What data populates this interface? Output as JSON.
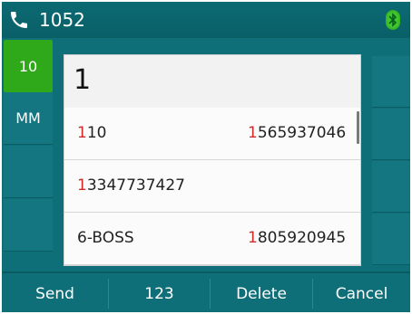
{
  "status": {
    "line_number": "1052"
  },
  "left_buttons": [
    {
      "label": "10"
    },
    {
      "label": "MM"
    }
  ],
  "search": {
    "input_value": "1"
  },
  "results": [
    {
      "name_prefix": "1",
      "name_rest": "10",
      "number_prefix": "1",
      "number_rest": "565937046"
    },
    {
      "name_prefix": "1",
      "name_rest": "3347737427",
      "number_prefix": "",
      "number_rest": ""
    },
    {
      "name_prefix": "",
      "name_rest": "6-BOSS",
      "number_prefix": "1",
      "number_rest": "805920945"
    }
  ],
  "softkeys": [
    "Send",
    "123",
    "Delete",
    "Cancel"
  ],
  "colors": {
    "background": "#0f6f78",
    "active_button": "#2fa81a",
    "highlight": "#d02a2a",
    "bluetooth": "#3fc82d"
  },
  "icons": {
    "phone": "phone-icon",
    "bluetooth": "bluetooth-icon"
  }
}
